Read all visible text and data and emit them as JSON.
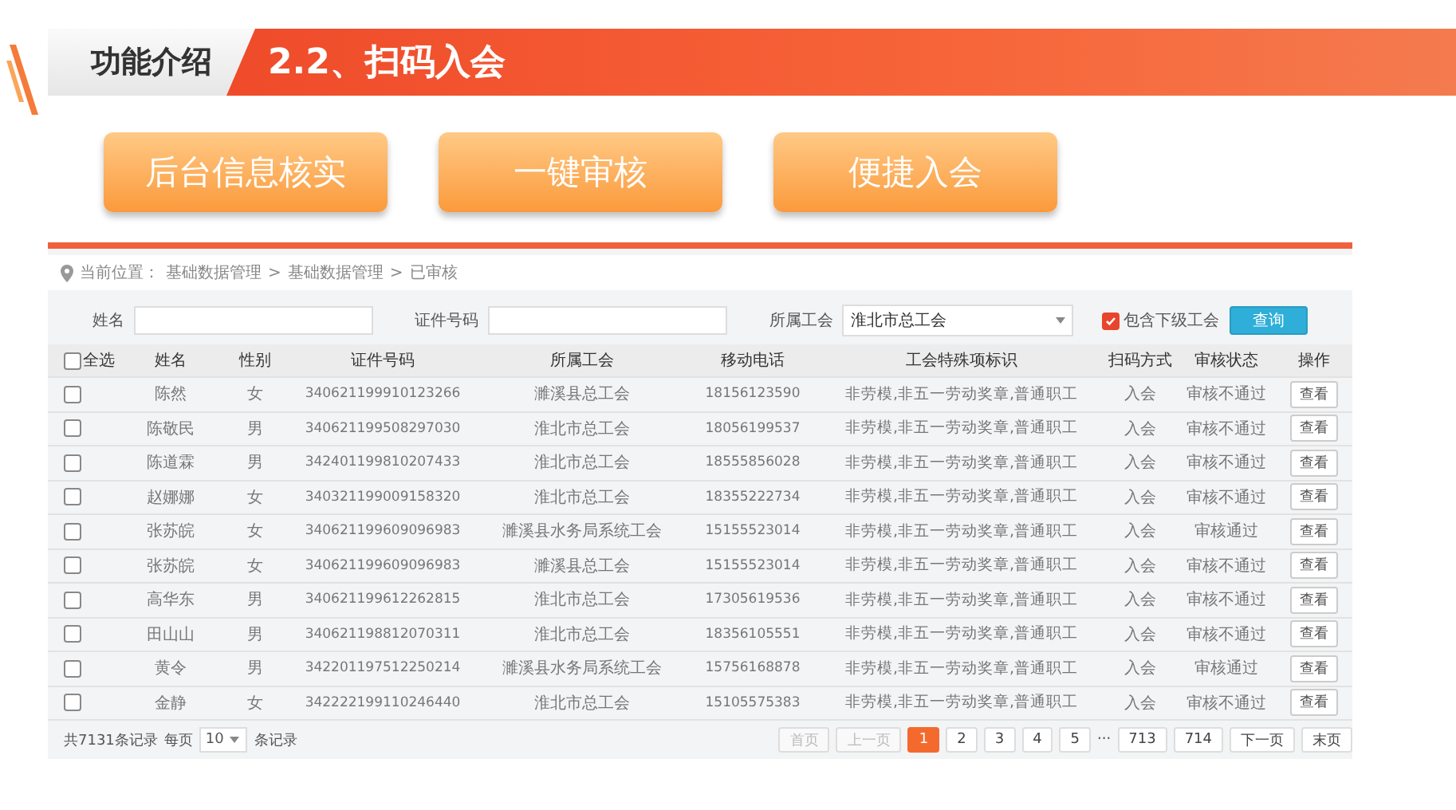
{
  "header": {
    "section": "功能介绍",
    "title": "2.2、扫码入会"
  },
  "features": [
    "后台信息核实",
    "一键审核",
    "便捷入会"
  ],
  "breadcrumb": {
    "label": "当前位置：",
    "items": [
      "基础数据管理",
      "基础数据管理",
      "已审核"
    ],
    "separator": ">"
  },
  "filters": {
    "name_label": "姓名",
    "id_label": "证件号码",
    "union_label": "所属工会",
    "union_value": "淮北市总工会",
    "include_sub": {
      "label": "包含下级工会",
      "checked": true
    },
    "query_button": "查询"
  },
  "table": {
    "select_all": {
      "label": "全选",
      "checked": false
    },
    "columns": [
      "姓名",
      "性别",
      "证件号码",
      "所属工会",
      "移动电话",
      "工会特殊项标识",
      "扫码方式",
      "审核状态",
      "操作"
    ],
    "rows": [
      {
        "checked": false,
        "cells": [
          "陈然",
          "女",
          "340621199910123266",
          "濉溪县总工会",
          "18156123590",
          "非劳模,非五一劳动奖章,普通职工",
          "入会",
          "审核不通过"
        ],
        "action": "查看"
      },
      {
        "checked": false,
        "cells": [
          "陈敬民",
          "男",
          "340621199508297030",
          "淮北市总工会",
          "18056199537",
          "非劳模,非五一劳动奖章,普通职工",
          "入会",
          "审核不通过"
        ],
        "action": "查看"
      },
      {
        "checked": false,
        "cells": [
          "陈道霖",
          "男",
          "342401199810207433",
          "淮北市总工会",
          "18555856028",
          "非劳模,非五一劳动奖章,普通职工",
          "入会",
          "审核不通过"
        ],
        "action": "查看"
      },
      {
        "checked": false,
        "cells": [
          "赵娜娜",
          "女",
          "340321199009158320",
          "淮北市总工会",
          "18355222734",
          "非劳模,非五一劳动奖章,普通职工",
          "入会",
          "审核不通过"
        ],
        "action": "查看"
      },
      {
        "checked": false,
        "cells": [
          "张苏皖",
          "女",
          "340621199609096983",
          "濉溪县水务局系统工会",
          "15155523014",
          "非劳模,非五一劳动奖章,普通职工",
          "入会",
          "审核通过"
        ],
        "action": "查看"
      },
      {
        "checked": false,
        "cells": [
          "张苏皖",
          "女",
          "340621199609096983",
          "濉溪县总工会",
          "15155523014",
          "非劳模,非五一劳动奖章,普通职工",
          "入会",
          "审核不通过"
        ],
        "action": "查看"
      },
      {
        "checked": false,
        "cells": [
          "高华东",
          "男",
          "340621199612262815",
          "淮北市总工会",
          "17305619536",
          "非劳模,非五一劳动奖章,普通职工",
          "入会",
          "审核不通过"
        ],
        "action": "查看"
      },
      {
        "checked": false,
        "cells": [
          "田山山",
          "男",
          "340621198812070311",
          "淮北市总工会",
          "18356105551",
          "非劳模,非五一劳动奖章,普通职工",
          "入会",
          "审核不通过"
        ],
        "action": "查看"
      },
      {
        "checked": false,
        "cells": [
          "黄令",
          "男",
          "342201197512250214",
          "濉溪县水务局系统工会",
          "15756168878",
          "非劳模,非五一劳动奖章,普通职工",
          "入会",
          "审核通过"
        ],
        "action": "查看"
      },
      {
        "checked": false,
        "cells": [
          "金静",
          "女",
          "342222199110246440",
          "淮北市总工会",
          "15105575383",
          "非劳模,非五一劳动奖章,普通职工",
          "入会",
          "审核不通过"
        ],
        "action": "查看"
      }
    ]
  },
  "footer": {
    "total": "共7131条记录",
    "per_page_label": "每页",
    "per_page": "10",
    "per_page_suffix": "条记录"
  },
  "pagination": [
    {
      "kind": "nav",
      "label": "首页",
      "disabled": true,
      "selected": false
    },
    {
      "kind": "nav",
      "label": "上一页",
      "disabled": true,
      "selected": false
    },
    {
      "kind": "page",
      "label": "1",
      "disabled": false,
      "selected": true
    },
    {
      "kind": "page",
      "label": "2",
      "disabled": false,
      "selected": false
    },
    {
      "kind": "page",
      "label": "3",
      "disabled": false,
      "selected": false
    },
    {
      "kind": "page",
      "label": "4",
      "disabled": false,
      "selected": false
    },
    {
      "kind": "page",
      "label": "5",
      "disabled": false,
      "selected": false
    },
    {
      "kind": "ellipsis",
      "label": "···"
    },
    {
      "kind": "page",
      "label": "713",
      "disabled": false,
      "selected": false
    },
    {
      "kind": "page",
      "label": "714",
      "disabled": false,
      "selected": false
    },
    {
      "kind": "nav",
      "label": "下一页",
      "disabled": false,
      "selected": false
    },
    {
      "kind": "nav",
      "label": "末页",
      "disabled": false,
      "selected": false
    }
  ]
}
